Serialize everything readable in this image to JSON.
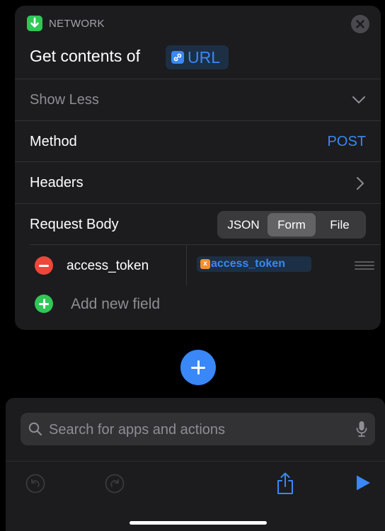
{
  "action": {
    "category_label": "NETWORK",
    "title": "Get contents of",
    "variable_label": "URL"
  },
  "options": {
    "show_less_label": "Show Less",
    "method_label": "Method",
    "method_value": "POST",
    "headers_label": "Headers",
    "request_body_label": "Request Body",
    "body_types": [
      "JSON",
      "Form",
      "File"
    ],
    "selected_body_type": "Form"
  },
  "fields": [
    {
      "key": "access_token",
      "value": "access_token"
    }
  ],
  "add_field_label": "Add new field",
  "search": {
    "placeholder": "Search for apps and actions"
  },
  "colors": {
    "accent": "#3a87f7",
    "card": "#1c1c1e",
    "network_green": "#30c756",
    "remove_red": "#f0453a",
    "variable_orange": "#f3902f"
  },
  "icons": {
    "category": "download-arrow-icon",
    "close": "close-icon",
    "variable": "link-icon",
    "undo": "undo-icon",
    "redo": "redo-icon",
    "share": "share-icon",
    "run": "play-icon"
  }
}
